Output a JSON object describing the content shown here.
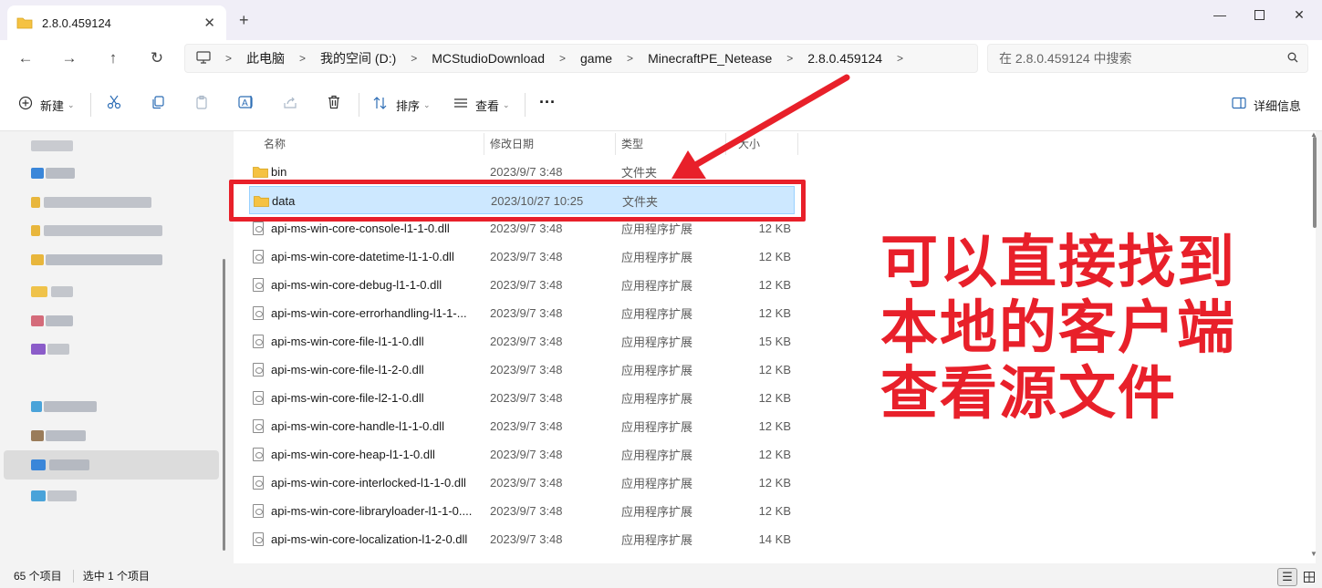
{
  "window": {
    "tab_title": "2.8.0.459124",
    "controls": [
      "minimize",
      "maximize",
      "close"
    ]
  },
  "nav": {
    "back_icon": "arrow-left-icon",
    "forward_icon": "arrow-right-icon",
    "up_icon": "arrow-up-icon",
    "refresh_icon": "refresh-icon"
  },
  "breadcrumb": {
    "items": [
      "此电脑",
      "我的空间 (D:)",
      "MCStudioDownload",
      "game",
      "MinecraftPE_Netease",
      "2.8.0.459124"
    ]
  },
  "search": {
    "placeholder": "在 2.8.0.459124 中搜索"
  },
  "toolbar": {
    "new_label": "新建",
    "sort_label": "排序",
    "view_label": "查看",
    "details_label": "详细信息"
  },
  "columns": {
    "name": "名称",
    "date": "修改日期",
    "type": "类型",
    "size": "大小"
  },
  "files": [
    {
      "name": "bin",
      "date": "2023/9/7 3:48",
      "type": "文件夹",
      "size": "",
      "icon": "folder",
      "selected": false
    },
    {
      "name": "data",
      "date": "2023/10/27 10:25",
      "type": "文件夹",
      "size": "",
      "icon": "folder",
      "selected": true
    },
    {
      "name": "api-ms-win-core-console-l1-1-0.dll",
      "date": "2023/9/7 3:48",
      "type": "应用程序扩展",
      "size": "12 KB",
      "icon": "dll",
      "selected": false
    },
    {
      "name": "api-ms-win-core-datetime-l1-1-0.dll",
      "date": "2023/9/7 3:48",
      "type": "应用程序扩展",
      "size": "12 KB",
      "icon": "dll",
      "selected": false
    },
    {
      "name": "api-ms-win-core-debug-l1-1-0.dll",
      "date": "2023/9/7 3:48",
      "type": "应用程序扩展",
      "size": "12 KB",
      "icon": "dll",
      "selected": false
    },
    {
      "name": "api-ms-win-core-errorhandling-l1-1-...",
      "date": "2023/9/7 3:48",
      "type": "应用程序扩展",
      "size": "12 KB",
      "icon": "dll",
      "selected": false
    },
    {
      "name": "api-ms-win-core-file-l1-1-0.dll",
      "date": "2023/9/7 3:48",
      "type": "应用程序扩展",
      "size": "15 KB",
      "icon": "dll",
      "selected": false
    },
    {
      "name": "api-ms-win-core-file-l1-2-0.dll",
      "date": "2023/9/7 3:48",
      "type": "应用程序扩展",
      "size": "12 KB",
      "icon": "dll",
      "selected": false
    },
    {
      "name": "api-ms-win-core-file-l2-1-0.dll",
      "date": "2023/9/7 3:48",
      "type": "应用程序扩展",
      "size": "12 KB",
      "icon": "dll",
      "selected": false
    },
    {
      "name": "api-ms-win-core-handle-l1-1-0.dll",
      "date": "2023/9/7 3:48",
      "type": "应用程序扩展",
      "size": "12 KB",
      "icon": "dll",
      "selected": false
    },
    {
      "name": "api-ms-win-core-heap-l1-1-0.dll",
      "date": "2023/9/7 3:48",
      "type": "应用程序扩展",
      "size": "12 KB",
      "icon": "dll",
      "selected": false
    },
    {
      "name": "api-ms-win-core-interlocked-l1-1-0.dll",
      "date": "2023/9/7 3:48",
      "type": "应用程序扩展",
      "size": "12 KB",
      "icon": "dll",
      "selected": false
    },
    {
      "name": "api-ms-win-core-libraryloader-l1-1-0....",
      "date": "2023/9/7 3:48",
      "type": "应用程序扩展",
      "size": "12 KB",
      "icon": "dll",
      "selected": false
    },
    {
      "name": "api-ms-win-core-localization-l1-2-0.dll",
      "date": "2023/9/7 3:48",
      "type": "应用程序扩展",
      "size": "14 KB",
      "icon": "dll",
      "selected": false
    }
  ],
  "annotation": {
    "lines": [
      "可以直接找到",
      "本地的客户端",
      "查看源文件"
    ],
    "color": "#e8202a"
  },
  "status": {
    "item_count": "65 个项目",
    "selected": "选中 1 个项目"
  },
  "colors": {
    "selected_row": "#cde8ff",
    "folder": "#f5c242",
    "annotation": "#e8202a"
  }
}
